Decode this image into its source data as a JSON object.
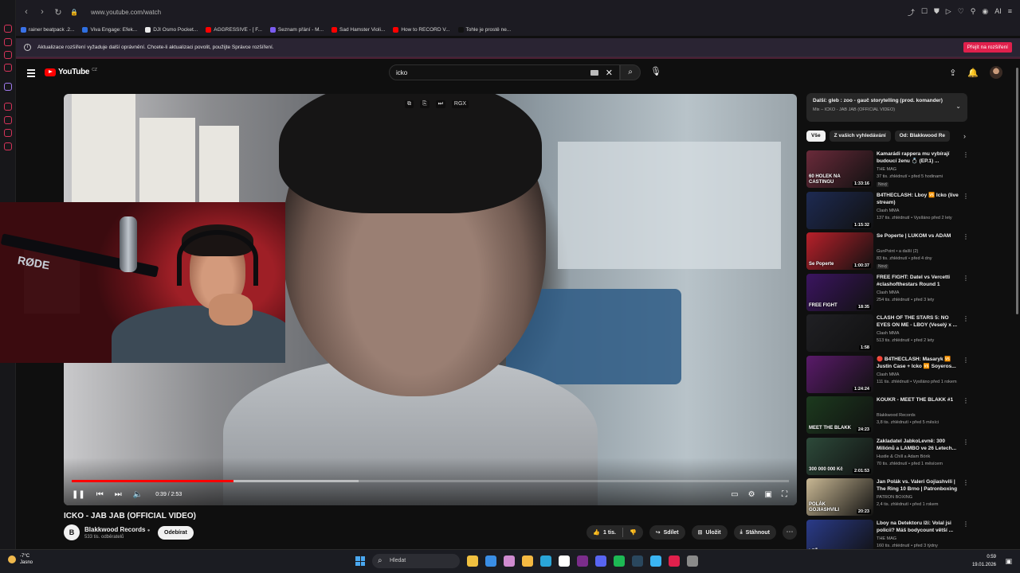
{
  "browser": {
    "url": "www.youtube.com/watch",
    "bookmarks": [
      "rainer beatpack .2...",
      "Viva Engage: Efek...",
      "DJI Osmo Pocket...",
      "AGGRESSIVE - [ F...",
      "Seznam přání - M...",
      "Sad Hamster Violi...",
      "How to RECORD V...",
      "Tohle je prostě ne..."
    ],
    "bookmark_colors": [
      "#3a72e8",
      "#2f6fe0",
      "#eaeaea",
      "#ff0000",
      "#7b5cf0",
      "#ff0000",
      "#ff0000",
      "#111111"
    ],
    "notification": {
      "text": "Aktualizace rozšíření vyžaduje další oprávnění. Chcete-li aktualizaci povolit, použijte Správce rozšíření.",
      "button": "Přejít na rozšíření"
    },
    "toolbar_icons": [
      "share-icon",
      "bookmark-icon",
      "shield-icon",
      "play-icon",
      "heart-icon",
      "extensions-icon",
      "profile-icon",
      "menu-icon"
    ],
    "ai_label": "AI"
  },
  "youtube": {
    "logo_text": "YouTube",
    "logo_country": "CZ",
    "search": {
      "query": "icko"
    }
  },
  "player": {
    "hover_label": "RGX",
    "time": "0:39 / 2:53",
    "progress_played": 0.225,
    "progress_buffered": 0.4,
    "webcam_text": "RØDE"
  },
  "video": {
    "title": "ICKO - JAB JAB (OFFICIAL VIDEO)",
    "channel": "Blakkwood Records",
    "channel_initial": "B",
    "subscribers": "533 tis. odběratelů",
    "subscribe_label": "Odebírat",
    "likes": "1 tis.",
    "share": "Sdílet",
    "save": "Uložit",
    "download": "Stáhnout"
  },
  "sidebar": {
    "next": {
      "title": "Další: gleb : zoo - gauč storytelling (prod. komander)",
      "subtitle": "Mix – ICKO - JAB JAB (OFFICIAL VIDEO)"
    },
    "chips": [
      "Vše",
      "Z vašich vyhledávání",
      "Od: Blakkwood Re"
    ],
    "items": [
      {
        "title": "Kamarádi rappera mu vybírají budoucí ženu 💍 (EP.1) ...",
        "channel": "THE MAG",
        "meta": "37 tis. zhlédnutí • před 5 hodinami",
        "badge": "Nový",
        "duration": "1:33:16",
        "thumb": "#6a2a3a",
        "thumb_text": "60 HOLEK NA CASTINGU"
      },
      {
        "title": "B4THECLASH: Lboy 🆚 Icko (live stream)",
        "channel": "Clash MMA",
        "meta": "137 tis. zhlédnutí • Vysíláno před 2 lety",
        "badge": "",
        "duration": "1:15:32",
        "thumb": "#1d2a52",
        "thumb_text": ""
      },
      {
        "title": "Se Poperte | LUKOM vs ADAM",
        "channel": "GunPoint • a další (2)",
        "meta": "83 tis. zhlédnutí • před 4 dny",
        "badge": "Nový",
        "duration": "1:00:37",
        "thumb": "#b8202a",
        "thumb_text": "Se Poperte"
      },
      {
        "title": "FREE FIGHT: Datel vs Vercetti #clashofthestars Round 1",
        "channel": "Clash MMA",
        "meta": "254 tis. zhlédnutí • před 3 lety",
        "badge": "",
        "duration": "18:35",
        "thumb": "#3b1460",
        "thumb_text": "FREE FIGHT"
      },
      {
        "title": "CLASH OF THE STARS 5: NO EYES ON ME - LBOY (Veselý x ...",
        "channel": "Clash MMA",
        "meta": "513 tis. zhlédnutí • před 2 lety",
        "badge": "",
        "duration": "1:58",
        "thumb": "#202024",
        "thumb_text": ""
      },
      {
        "title": "🔴 B4THECLASH: Masaryk 🆚 Justin Case + Icko 🆚 Soyeros...",
        "channel": "Clash MMA",
        "meta": "111 tis. zhlédnutí • Vysíláno před 1 rokem",
        "badge": "",
        "duration": "1:24:24",
        "thumb": "#5a1a6a",
        "thumb_text": ""
      },
      {
        "title": "KOUKR - MEET THE BLAKK #1",
        "channel": "Blakkwood Records",
        "meta": "3,8 tis. zhlédnutí • před 5 měsíci",
        "badge": "",
        "duration": "24:23",
        "thumb": "#1c3a1e",
        "thumb_text": "MEET THE BLAKK"
      },
      {
        "title": "Zakladatel JabkoLevně: 300 Miliónů a LAMBO ve 26 Letech...",
        "channel": "Hustle & Chill a Adam Bórik",
        "meta": "70 tis. zhlédnutí • před 1 měsícem",
        "badge": "",
        "duration": "2:01:53",
        "thumb": "#2d4a3a",
        "thumb_text": "300 000 000 Kč"
      },
      {
        "title": "Jan Polák vs. Valeri Gojiashvili | The Ring 10 Brno | Patronboxing",
        "channel": "PATRON BOXING",
        "meta": "2,4 tis. zhlédnutí • před 1 rokem",
        "badge": "",
        "duration": "20:23",
        "thumb": "#c9b894",
        "thumb_text": "POLÁK GOJIASHVILI"
      },
      {
        "title": "Lboy na Detektoru lží: Volal jsi policii? Máš bodycount větší ...",
        "channel": "THE MAG",
        "meta": "160 tis. zhlédnutí • před 3 týdny",
        "badge": "",
        "duration": "",
        "thumb": "#2a3b8a",
        "thumb_text": "LEŽ"
      }
    ]
  },
  "taskbar": {
    "temp": "-7°C",
    "weather": "Jasno",
    "search": "Hledat",
    "time": "0:59",
    "date": "19.01.2026",
    "apps": [
      "#f0c040",
      "#3a8ee6",
      "#d08bd0",
      "#f5b942",
      "#2aa5d8",
      "#ffffff",
      "#7b2d8b",
      "#5865f2",
      "#1db954",
      "#2a475e",
      "#3ab4f2",
      "#e0204c",
      "#8a8a8a"
    ]
  }
}
